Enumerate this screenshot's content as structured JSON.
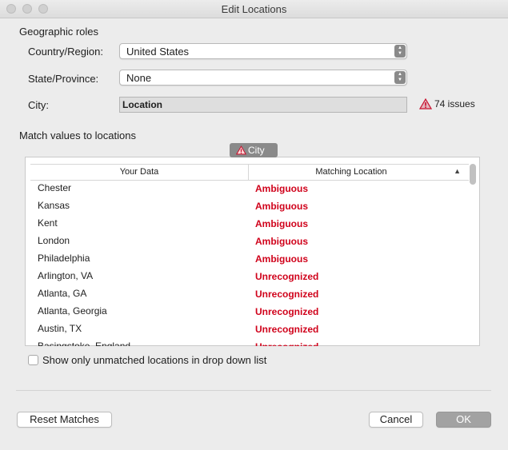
{
  "window": {
    "title": "Edit Locations"
  },
  "geographic_roles": {
    "heading": "Geographic roles",
    "country_label": "Country/Region:",
    "country_value": "United States",
    "state_label": "State/Province:",
    "state_value": "None",
    "city_label": "City:",
    "city_value": "Location",
    "issues_text": "74 issues"
  },
  "match": {
    "heading": "Match values to locations",
    "badge_label": "City",
    "columns": [
      "Your Data",
      "Matching Location"
    ],
    "sort_indicator": "▲",
    "rows": [
      {
        "data": "Chester",
        "match": "Ambiguous"
      },
      {
        "data": "Kansas",
        "match": "Ambiguous"
      },
      {
        "data": "Kent",
        "match": "Ambiguous"
      },
      {
        "data": "London",
        "match": "Ambiguous"
      },
      {
        "data": "Philadelphia",
        "match": "Ambiguous"
      },
      {
        "data": "Arlington, VA",
        "match": "Unrecognized"
      },
      {
        "data": "Atlanta, GA",
        "match": "Unrecognized"
      },
      {
        "data": "Atlanta, Georgia",
        "match": "Unrecognized"
      },
      {
        "data": "Austin, TX",
        "match": "Unrecognized"
      },
      {
        "data": "Basingstoke, England",
        "match": "Unrecognized"
      }
    ]
  },
  "options": {
    "show_unmatched_label": "Show only unmatched locations in drop down list",
    "show_unmatched_checked": false
  },
  "buttons": {
    "reset": "Reset Matches",
    "cancel": "Cancel",
    "ok": "OK"
  },
  "colors": {
    "status_red": "#d0021b",
    "warning_red": "#c8102e",
    "badge_gray": "#8a8a8a"
  },
  "icons": {
    "warning": "warning-triangle-icon",
    "stepper": "updown-chevron-icon",
    "sort": "sort-ascending-icon"
  }
}
